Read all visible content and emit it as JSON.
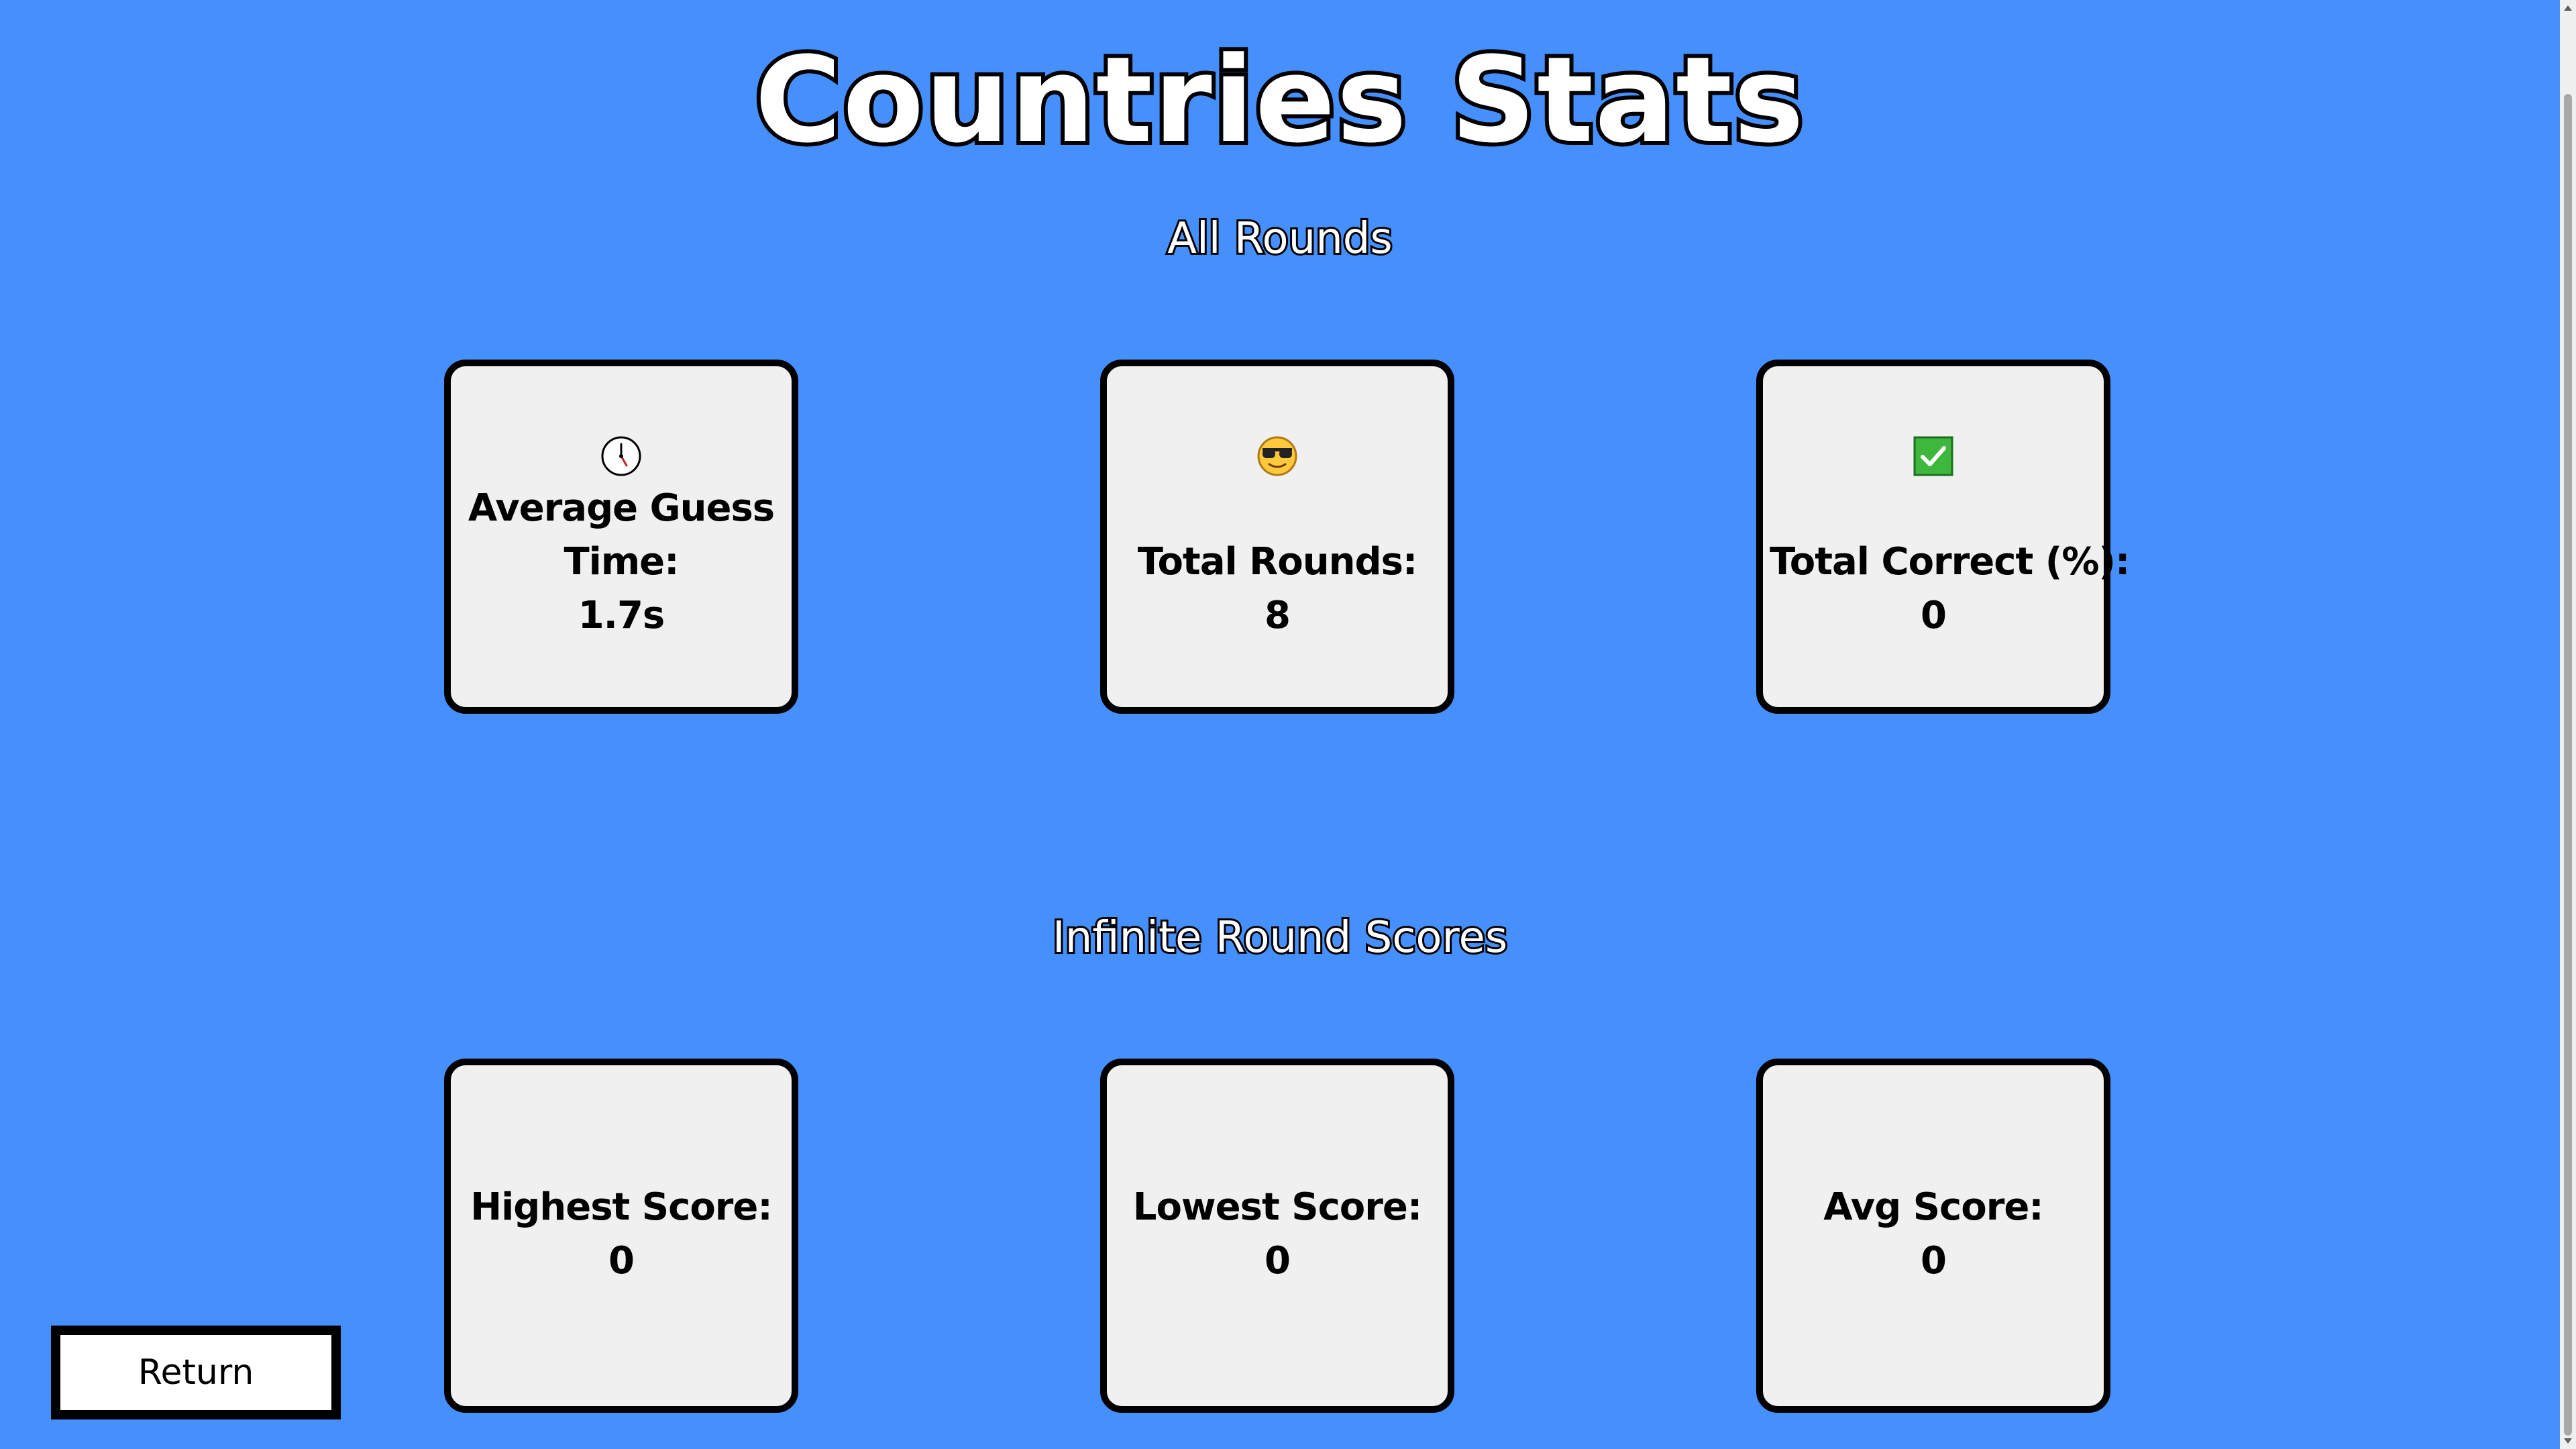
{
  "title": "Countries Stats",
  "sections": {
    "all_rounds": {
      "heading": "All Rounds",
      "cards": {
        "avg_guess_time": {
          "icon": "clock-icon",
          "label_line1": "Average Guess",
          "label_line2": "Time:",
          "value": "1.7s"
        },
        "total_rounds": {
          "icon": "sunglasses-face-icon",
          "label": "Total Rounds:",
          "value": "8"
        },
        "total_correct": {
          "icon": "check-mark-icon",
          "label": "Total Correct (%):",
          "value": "0"
        }
      }
    },
    "infinite_rounds": {
      "heading": "Infinite Round Scores",
      "cards": {
        "highest": {
          "label": "Highest Score:",
          "value": "0"
        },
        "lowest": {
          "label": "Lowest Score:",
          "value": "0"
        },
        "average": {
          "label": "Avg Score:",
          "value": "0"
        }
      }
    }
  },
  "return_button": {
    "label": "Return"
  },
  "colors": {
    "background": "#4690FE",
    "card_background": "#F0F0F0",
    "card_border": "#000000",
    "check_green": "#3DB83D"
  }
}
